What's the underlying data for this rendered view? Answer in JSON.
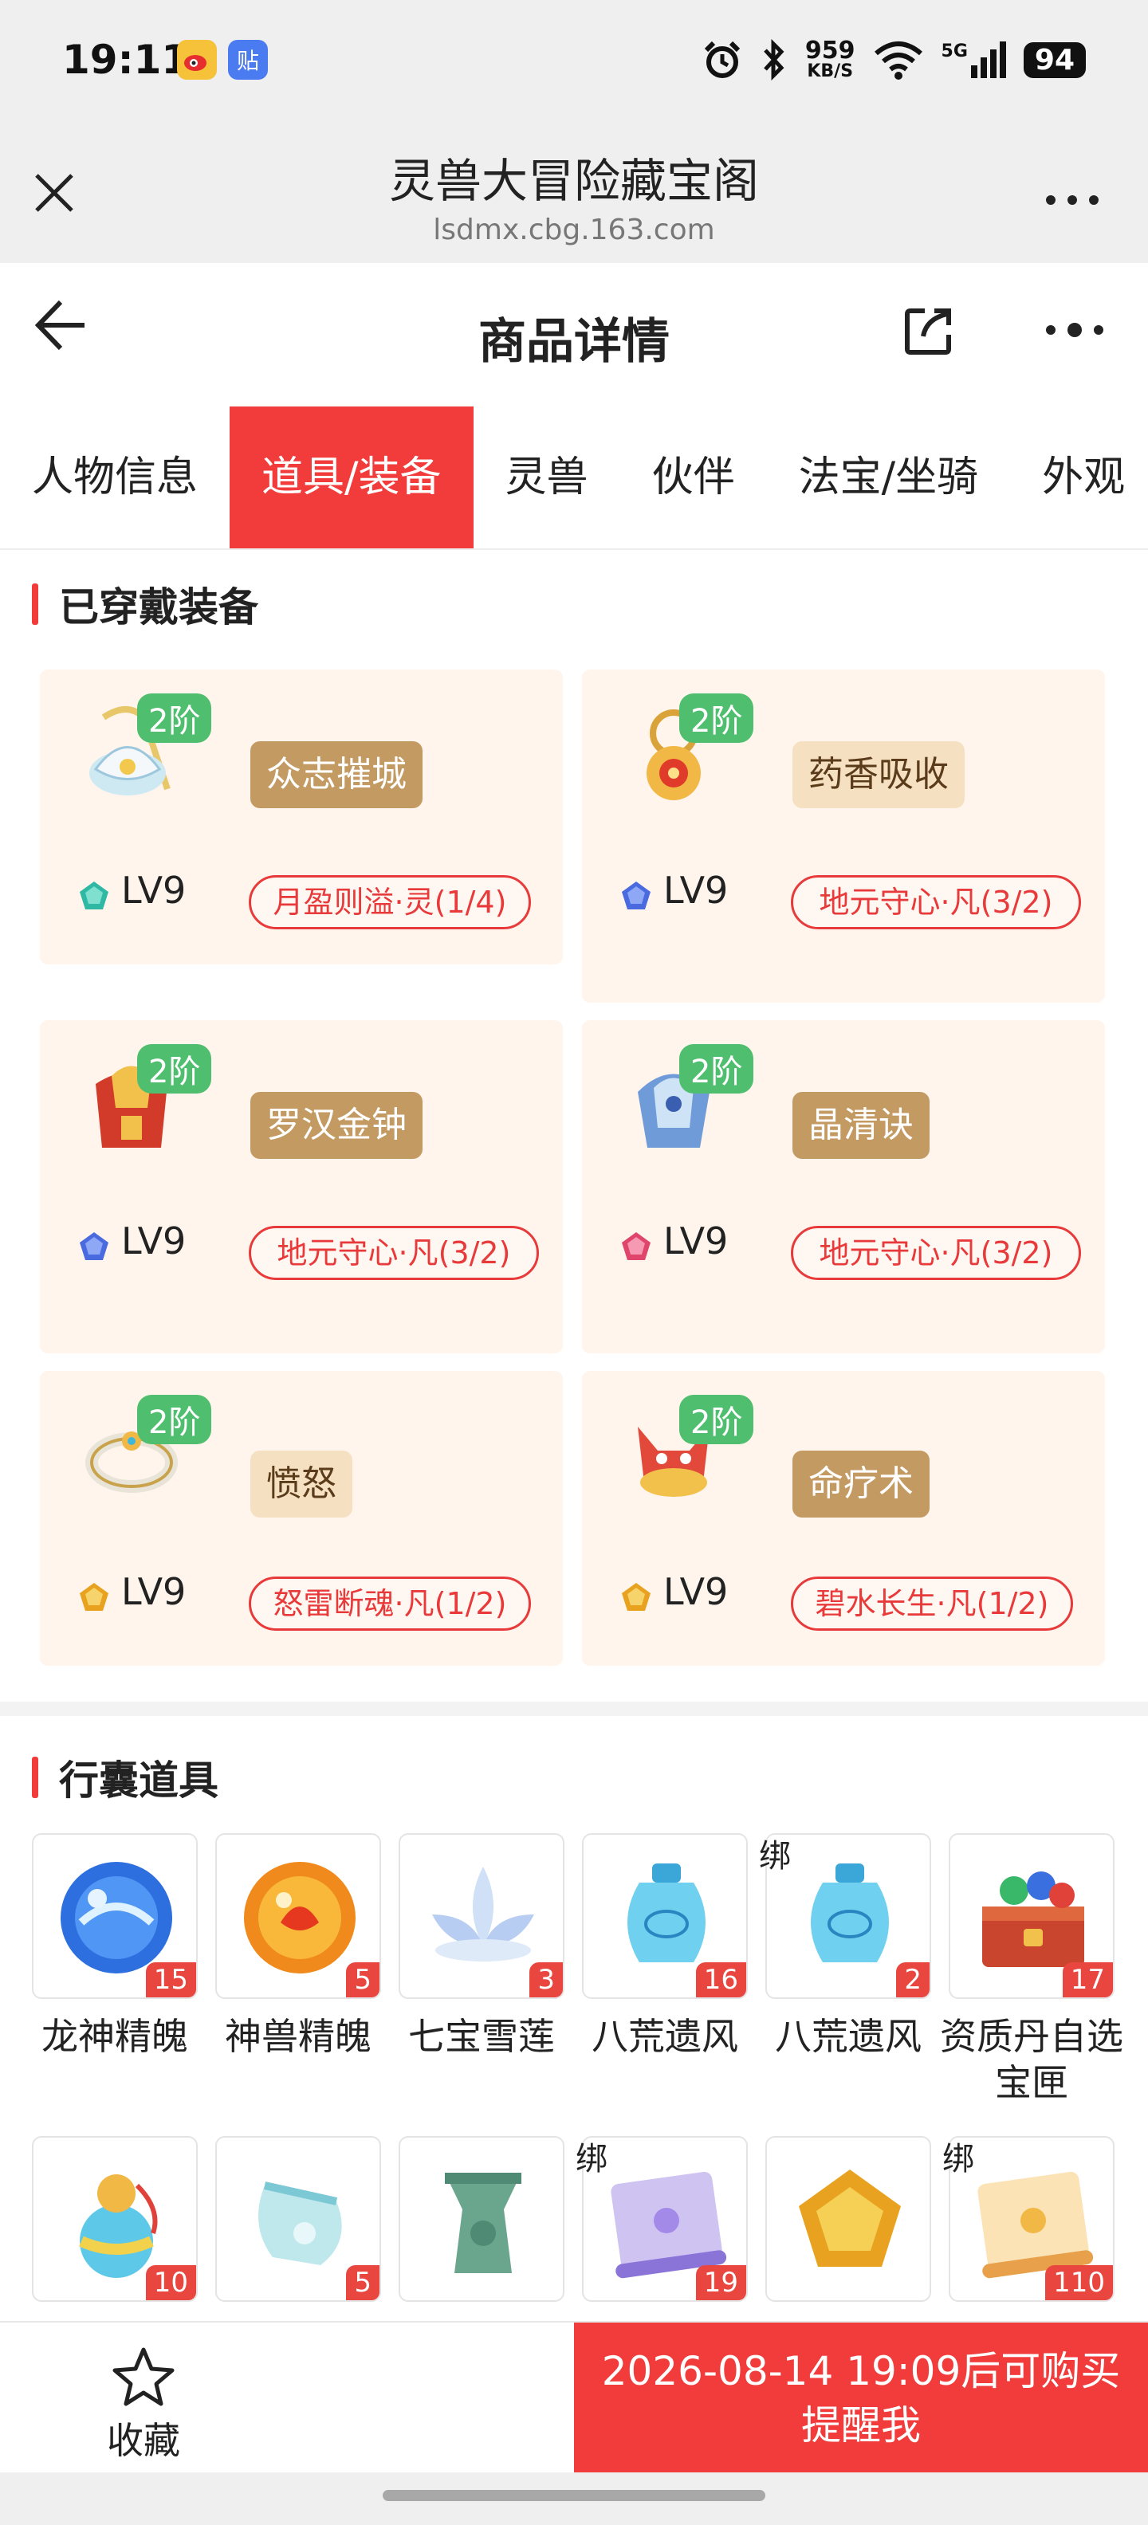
{
  "status_bar": {
    "time": "19:11",
    "speed_value": "959",
    "speed_unit": "KB/S",
    "network": "5G",
    "battery": "94",
    "app_icon_1": "weibo-icon",
    "app_icon_2": "tieba-icon"
  },
  "browser": {
    "title": "灵兽大冒险藏宝阁",
    "url": "lsdmx.cbg.163.com"
  },
  "nav": {
    "title": "商品详情"
  },
  "tabs": [
    "人物信息",
    "道具/装备",
    "灵兽",
    "伙伴",
    "法宝/坐骑",
    "外观"
  ],
  "active_tab": 1,
  "equipped": {
    "title": "已穿戴装备",
    "items": [
      {
        "grade": "2阶",
        "name": "众志摧城",
        "level": "LV9",
        "skill": "月盈则溢·灵(1/4)",
        "gem_color": "#2fb8a3",
        "name_style": "brown"
      },
      {
        "grade": "2阶",
        "name": "药香吸收",
        "level": "LV9",
        "skill": "地元守心·凡(3/2)",
        "gem_color": "#4a6be0",
        "name_style": "light"
      },
      {
        "grade": "2阶",
        "name": "罗汉金钟",
        "level": "LV9",
        "skill": "地元守心·凡(3/2)",
        "gem_color": "#4a6be0",
        "name_style": "brown"
      },
      {
        "grade": "2阶",
        "name": "晶清诀",
        "level": "LV9",
        "skill": "地元守心·凡(3/2)",
        "gem_color": "#e0456b",
        "name_style": "brown"
      },
      {
        "grade": "2阶",
        "name": "愤怒",
        "level": "LV9",
        "skill": "怒雷断魂·凡(1/2)",
        "gem_color": "#e8a21f",
        "name_style": "light"
      },
      {
        "grade": "2阶",
        "name": "命疗术",
        "level": "LV9",
        "skill": "碧水长生·凡(1/2)",
        "gem_color": "#e8a21f",
        "name_style": "brown"
      }
    ]
  },
  "bag": {
    "title": "行囊道具",
    "items": [
      {
        "name": "龙神精魄",
        "count": "15",
        "bound": "",
        "icon": "blue-orb-icon"
      },
      {
        "name": "神兽精魄",
        "count": "5",
        "bound": "",
        "icon": "fire-orb-icon"
      },
      {
        "name": "七宝雪莲",
        "count": "3",
        "bound": "",
        "icon": "snow-lotus-icon"
      },
      {
        "name": "八荒遗风",
        "count": "16",
        "bound": "",
        "icon": "wind-vase-icon"
      },
      {
        "name": "八荒遗风",
        "count": "2",
        "bound": "绑",
        "icon": "wind-vase-icon"
      },
      {
        "name": "资质丹自选宝匣",
        "count": "17",
        "bound": "",
        "icon": "treasure-chest-icon"
      },
      {
        "name": "",
        "count": "10",
        "bound": "",
        "icon": "potion-gourd-icon"
      },
      {
        "name": "",
        "count": "5",
        "bound": "",
        "icon": "jade-vase-icon"
      },
      {
        "name": "",
        "count": "",
        "bound": "",
        "icon": "bronze-vessel-icon"
      },
      {
        "name": "",
        "count": "19",
        "bound": "绑",
        "icon": "purple-scroll-icon"
      },
      {
        "name": "",
        "count": "",
        "bound": "",
        "icon": "gold-gem-icon"
      },
      {
        "name": "",
        "count": "110",
        "bound": "绑",
        "icon": "gold-scroll-icon"
      }
    ]
  },
  "bottom": {
    "favorite_label": "收藏",
    "buy_line1": "2026-08-14 19:09后可购买",
    "buy_line2": "提醒我"
  },
  "colors": {
    "accent": "#f23b3b",
    "grade_badge": "#4fbf6f",
    "card_bg": "#fff5ec",
    "name_brown": "#c49a63"
  }
}
